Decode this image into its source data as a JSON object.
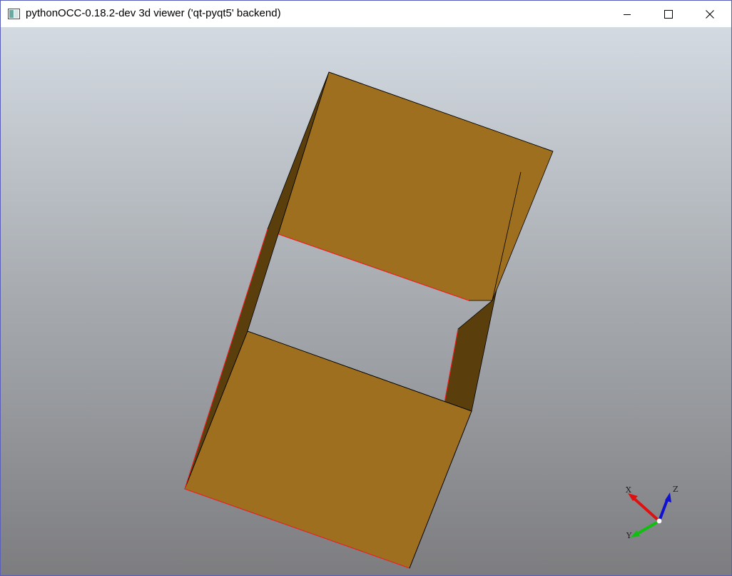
{
  "window": {
    "title": "pythonOCC-0.18.2-dev 3d viewer ('qt-pyqt5' backend)",
    "icon": "app-window-icon",
    "controls": {
      "minimize": "minimize-icon",
      "maximize": "maximize-icon",
      "close": "close-icon"
    }
  },
  "viewer": {
    "background_top": "#d3dae1",
    "background_bottom": "#7d7d80",
    "face_color": "#9d6f1e",
    "side_face_color": "#5a3f0c",
    "edge_color": "#000000",
    "free_edge_color": "#ff2020"
  },
  "trihedron": {
    "x_label": "X",
    "y_label": "Y",
    "z_label": "Z",
    "x_color": "#e01010",
    "y_color": "#10c010",
    "z_color": "#1010d0"
  }
}
